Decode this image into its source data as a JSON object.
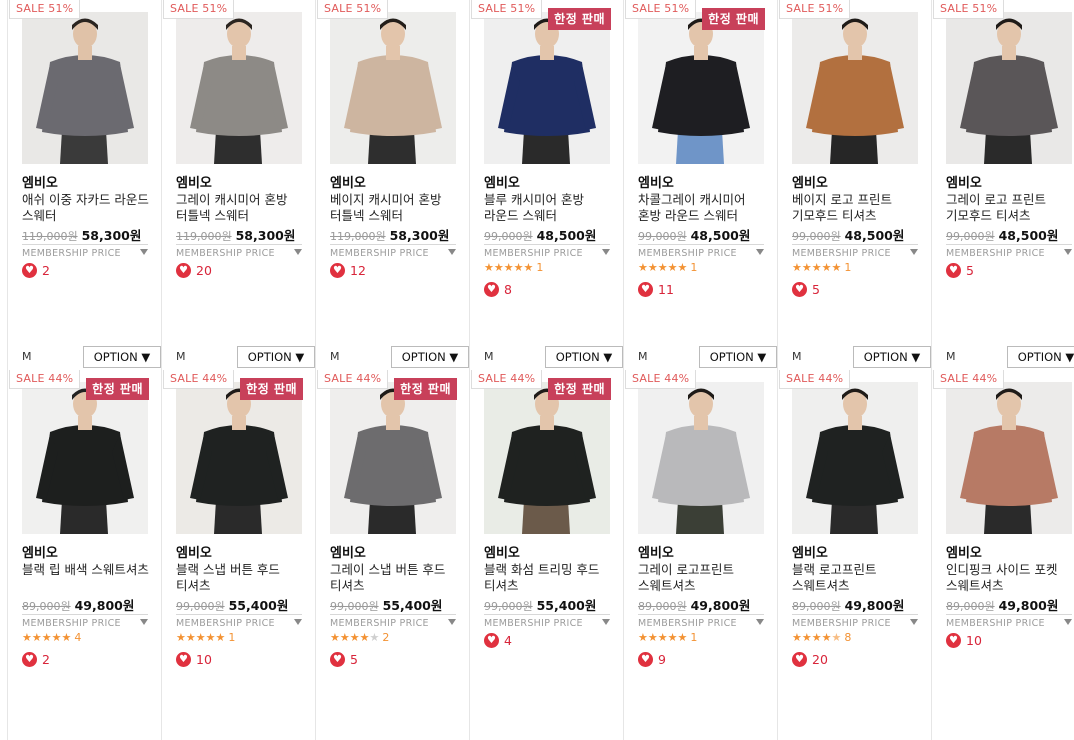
{
  "rows": [
    [
      {
        "sale": "SALE 51%",
        "badge": "",
        "brand": "엠비오",
        "name": "애쉬 이중 자카드 라운드 스웨터",
        "orig": "119,000원",
        "price": "58,300원",
        "member": "MEMBERSHIP PRICE",
        "stars": 0,
        "reviews": "",
        "likes": "2",
        "size": "M",
        "option": "OPTION ▼",
        "garment": "#6b6a70",
        "bg": "#e9e8e6",
        "skin": "#e0c2a8",
        "hair": "#2a2420",
        "pants": "#3a3a3a"
      },
      {
        "sale": "SALE 51%",
        "badge": "",
        "brand": "엠비오",
        "name": "그레이 캐시미어 혼방 터틀넥 스웨터",
        "orig": "119,000원",
        "price": "58,300원",
        "member": "MEMBERSHIP PRICE",
        "stars": 0,
        "reviews": "",
        "likes": "20",
        "size": "M",
        "option": "OPTION ▼",
        "garment": "#8d8a86",
        "bg": "#eeeceb",
        "skin": "#e3c5ab",
        "hair": "#2b2520",
        "pants": "#2e2e2e"
      },
      {
        "sale": "SALE 51%",
        "badge": "",
        "brand": "엠비오",
        "name": "베이지 캐시미어 혼방 터틀넥 스웨터",
        "orig": "119,000원",
        "price": "58,300원",
        "member": "MEMBERSHIP PRICE",
        "stars": 0,
        "reviews": "",
        "likes": "12",
        "size": "M",
        "option": "OPTION ▼",
        "garment": "#cdb5a0",
        "bg": "#ededeb",
        "skin": "#e3c5ab",
        "hair": "#231e1a",
        "pants": "#2e2e2e"
      },
      {
        "sale": "SALE 51%",
        "badge": "한정 판매",
        "brand": "엠비오",
        "name": "블루 캐시미어 혼방 라운드 스웨터",
        "orig": "99,000원",
        "price": "48,500원",
        "member": "MEMBERSHIP PRICE",
        "stars": 5,
        "reviews": "1",
        "likes": "8",
        "size": "M",
        "option": "OPTION ▼",
        "garment": "#1f2e63",
        "bg": "#efefef",
        "skin": "#e3c5ab",
        "hair": "#1f1b18",
        "pants": "#2a2a2a"
      },
      {
        "sale": "SALE 51%",
        "badge": "한정 판매",
        "brand": "엠비오",
        "name": "차콜그레이 캐시미어 혼방 라운드 스웨터",
        "orig": "99,000원",
        "price": "48,500원",
        "member": "MEMBERSHIP PRICE",
        "stars": 5,
        "reviews": "1",
        "likes": "11",
        "size": "M",
        "option": "OPTION ▼",
        "garment": "#1e1e22",
        "bg": "#f2f2f2",
        "skin": "#e3c5ab",
        "hair": "#1f1b18",
        "pants": "#6f95c8"
      },
      {
        "sale": "SALE 51%",
        "badge": "",
        "brand": "엠비오",
        "name": "베이지 로고 프린트 기모후드 티셔츠",
        "orig": "99,000원",
        "price": "48,500원",
        "member": "MEMBERSHIP PRICE",
        "stars": 5,
        "reviews": "1",
        "likes": "5",
        "size": "M",
        "option": "OPTION ▼",
        "garment": "#b2703f",
        "bg": "#ecebea",
        "skin": "#e3c5ab",
        "hair": "#1f1b18",
        "pants": "#262626"
      },
      {
        "sale": "SALE 51%",
        "badge": "",
        "brand": "엠비오",
        "name": "그레이 로고 프린트 기모후드 티셔츠",
        "orig": "99,000원",
        "price": "48,500원",
        "member": "MEMBERSHIP PRICE",
        "stars": 0,
        "reviews": "",
        "likes": "5",
        "size": "M",
        "option": "OPTION ▼",
        "garment": "#5a5658",
        "bg": "#e9e8e7",
        "skin": "#e3c5ab",
        "hair": "#1f1b18",
        "pants": "#2a2a2a"
      }
    ],
    [
      {
        "sale": "SALE 44%",
        "badge": "한정 판매",
        "brand": "엠비오",
        "name": "블랙 립 배색 스웨트셔츠",
        "orig": "89,000원",
        "price": "49,800원",
        "member": "MEMBERSHIP PRICE",
        "stars": 5,
        "reviews": "4",
        "likes": "2",
        "size": "",
        "option": "",
        "garment": "#1d1f1e",
        "bg": "#f0f0ef",
        "skin": "#e3c5ab",
        "hair": "#222",
        "pants": "#2a2a2a"
      },
      {
        "sale": "SALE 44%",
        "badge": "한정 판매",
        "brand": "엠비오",
        "name": "블랙 스냅 버튼 후드 티셔츠",
        "orig": "99,000원",
        "price": "55,400원",
        "member": "MEMBERSHIP PRICE",
        "stars": 5,
        "reviews": "1",
        "likes": "10",
        "size": "",
        "option": "",
        "garment": "#1f2221",
        "bg": "#eceae6",
        "skin": "#e3c5ab",
        "hair": "#1f1b18",
        "pants": "#2a2a2a"
      },
      {
        "sale": "SALE 44%",
        "badge": "한정 판매",
        "brand": "엠비오",
        "name": "그레이 스냅 버튼 후드 티셔츠",
        "orig": "99,000원",
        "price": "55,400원",
        "member": "MEMBERSHIP PRICE",
        "stars": 4,
        "reviews": "2",
        "likes": "5",
        "size": "",
        "option": "",
        "garment": "#6d6c6e",
        "bg": "#efeeed",
        "skin": "#e3c5ab",
        "hair": "#1f1b18",
        "pants": "#2a2a2a"
      },
      {
        "sale": "SALE 44%",
        "badge": "한정 판매",
        "brand": "엠비오",
        "name": "블랙 화섬 트리밍 후드 티셔츠",
        "orig": "99,000원",
        "price": "55,400원",
        "member": "MEMBERSHIP PRICE",
        "stars": 0,
        "reviews": "",
        "likes": "4",
        "size": "",
        "option": "",
        "garment": "#1f2220",
        "bg": "#e9ece6",
        "skin": "#e3c5ab",
        "hair": "#1f1b18",
        "pants": "#6b5a4a"
      },
      {
        "sale": "SALE 44%",
        "badge": "",
        "brand": "엠비오",
        "name": "그레이 로고프린트 스웨트셔츠",
        "orig": "89,000원",
        "price": "49,800원",
        "member": "MEMBERSHIP PRICE",
        "stars": 5,
        "reviews": "1",
        "likes": "9",
        "size": "",
        "option": "",
        "garment": "#b9b9bb",
        "bg": "#f0f0f0",
        "skin": "#e3c5ab",
        "hair": "#1f1b18",
        "pants": "#3b3f36"
      },
      {
        "sale": "SALE 44%",
        "badge": "",
        "brand": "엠비오",
        "name": "블랙 로고프린트 스웨트셔츠",
        "orig": "89,000원",
        "price": "49,800원",
        "member": "MEMBERSHIP PRICE",
        "stars": 4.5,
        "reviews": "8",
        "likes": "20",
        "size": "",
        "option": "",
        "garment": "#1f2221",
        "bg": "#efefee",
        "skin": "#e3c5ab",
        "hair": "#1f1b18",
        "pants": "#2a2a2a"
      },
      {
        "sale": "SALE 44%",
        "badge": "",
        "brand": "엠비오",
        "name": "인디핑크 사이드 포켓 스웨트셔츠",
        "orig": "89,000원",
        "price": "49,800원",
        "member": "MEMBERSHIP PRICE",
        "stars": 0,
        "reviews": "",
        "likes": "10",
        "size": "",
        "option": "",
        "garment": "#b77a65",
        "bg": "#ecebea",
        "skin": "#e3c5ab",
        "hair": "#1f1b18",
        "pants": "#2a2a2a"
      }
    ]
  ]
}
